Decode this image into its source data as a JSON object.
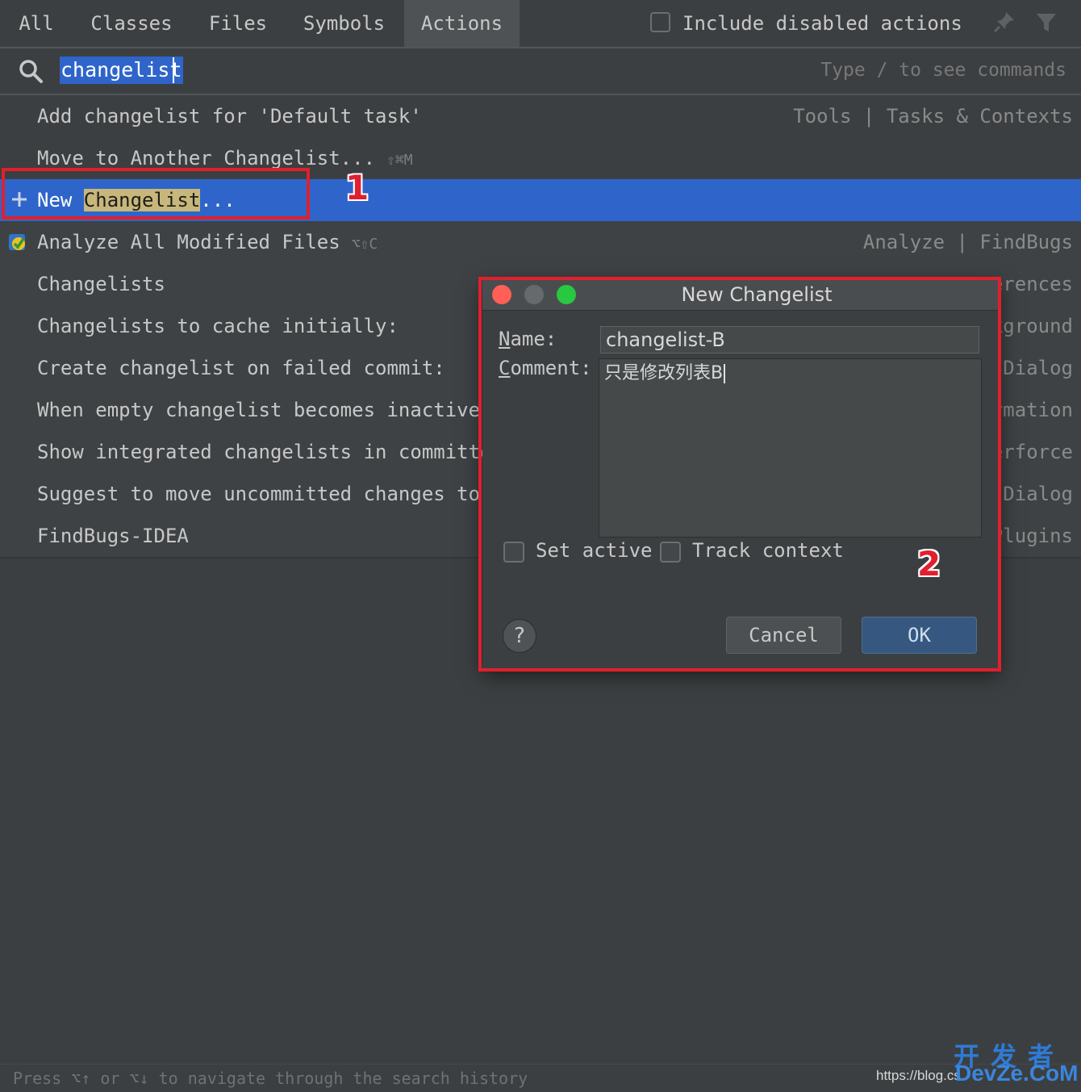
{
  "tabs": {
    "items": [
      "All",
      "Classes",
      "Files",
      "Symbols",
      "Actions"
    ],
    "active": "Actions",
    "include_disabled_label": "Include disabled actions"
  },
  "search": {
    "value": "changelist",
    "hint": "Type / to see commands"
  },
  "results": [
    {
      "label": "Add changelist for 'Default task'",
      "shortcut": "",
      "category": "Tools | Tasks & Contexts"
    },
    {
      "label": "Move to Another Changelist...",
      "shortcut": "⇧⌘M",
      "category": ""
    },
    {
      "label_pre": "New ",
      "label_hl": "Changelist",
      "label_post": "...",
      "category": "",
      "selected": true
    },
    {
      "label": "Analyze All Modified Files",
      "shortcut": "⌥⇧C",
      "category": "Analyze | FindBugs"
    },
    {
      "label": "Changelists",
      "category_partial": "erences"
    },
    {
      "label": "Changelists to cache initially:",
      "category_partial": "kground"
    },
    {
      "label": "Create changelist on failed commit:",
      "category_partial": "Dialog"
    },
    {
      "label": "When empty changelist becomes inactive",
      "category_partial": "rmation"
    },
    {
      "label": "Show integrated changelists in committe",
      "category_partial": "erforce"
    },
    {
      "label": "Suggest to move uncommitted changes to",
      "category_partial": "Dialog"
    },
    {
      "label": "FindBugs-IDEA",
      "category_partial": "Plugins"
    }
  ],
  "dialog": {
    "title": "New Changelist",
    "name_label_first": "N",
    "name_label_rest": "ame:",
    "name_value": "changelist-B",
    "comment_label_first": "C",
    "comment_label_rest": "omment:",
    "comment_value": "只是修改列表B",
    "set_active_label": "Set active",
    "track_context_label": "Track context",
    "help_label": "?",
    "cancel_label": "Cancel",
    "ok_label": "OK"
  },
  "annotations": {
    "one": "1",
    "two": "2",
    "color": "#e0202e"
  },
  "status_text": "Press ⌥↑ or ⌥↓ to navigate through the search history",
  "watermark": {
    "url": "https://blog.cs",
    "cn": "开发者",
    "en": "DevZe.CoM"
  },
  "colors": {
    "selection": "#2f65ca",
    "highlight": "#c8b77a",
    "background": "#3c3f41"
  }
}
